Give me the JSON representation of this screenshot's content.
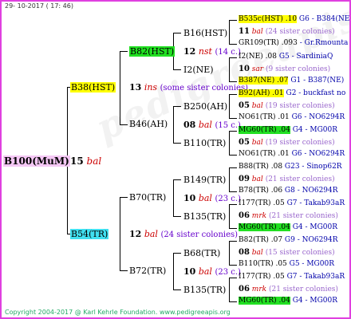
{
  "header": {
    "date": "29- 10-2017 ( 17: 46)"
  },
  "footer": {
    "copyright": "Copyright 2004-2017 @ Karl Kehrle Foundation.   www.pedigreeapis.org"
  },
  "root": {
    "name": "B100(MuM)",
    "num": "15",
    "tag": "bal"
  },
  "gen1": [
    {
      "name": "B38(HST)",
      "num": "13",
      "tag": "ins",
      "note": "(some sister colonies)"
    },
    {
      "name": "B54(TR)",
      "num": "12",
      "tag": "bal",
      "note": "(24 sister colonies)"
    }
  ],
  "gen2": [
    {
      "name": "B82(HST)"
    },
    {
      "name": "B46(AH)",
      "num": "08",
      "tag": "bal",
      "note": "(15 c.)"
    },
    {
      "name": "B70(TR)",
      "num": "10",
      "tag": "bal",
      "note": "(23 c.)"
    },
    {
      "name": "B72(TR)",
      "num": "10",
      "tag": "bal",
      "note": "(23 c.)"
    }
  ],
  "gen2b": {
    "num": "12",
    "tag": "nst",
    "note": "(14 c.)"
  },
  "gen3": [
    {
      "name": "B16(HST)"
    },
    {
      "name": "I2(NE)"
    },
    {
      "name": "B250(AH)"
    },
    {
      "name": "B110(TR)"
    },
    {
      "name": "B149(TR)"
    },
    {
      "name": "B135(TR)"
    },
    {
      "name": "B68(TR)"
    },
    {
      "name": "B135(TR)"
    }
  ],
  "gen4": [
    {
      "a": "B535c(HST) .10",
      "b": "G6 - B384(NE)"
    },
    {
      "num": "11",
      "tag": "bal",
      "note": "(24 sister colonies)"
    },
    {
      "a": "GR109(TR) .093",
      "b": "- Gr.Rmounta"
    },
    {
      "a": "I2(NE) .08",
      "b": "G5 - SardiniaQ"
    },
    {
      "num": "10",
      "tag": "sar",
      "note": "(9 sister colonies)"
    },
    {
      "a": "B387(NE) .07",
      "b": "G1 - B387(NE)"
    },
    {
      "a": "B92(AH) .01",
      "b": "G2 - buckfast no"
    },
    {
      "num": "05",
      "tag": "bal",
      "note": "(19 sister colonies)"
    },
    {
      "a": "NO61(TR) .01",
      "b": "G6 - NO6294R"
    },
    {
      "a": "MG60(TR) .04",
      "b": "G4 - MG00R"
    },
    {
      "num": "05",
      "tag": "bal",
      "note": "(19 sister colonies)"
    },
    {
      "a": "NO61(TR) .01",
      "b": "G6 - NO6294R"
    },
    {
      "a": "B88(TR) .08",
      "b": "G23 - Sinop62R"
    },
    {
      "num": "09",
      "tag": "bal",
      "note": "(21 sister colonies)"
    },
    {
      "a": "B78(TR) .06",
      "b": "G8 - NO6294R"
    },
    {
      "a": "I177(TR) .05",
      "b": "G7 - Takab93aR"
    },
    {
      "num": "06",
      "tag": "mrk",
      "note": "(21 sister colonies)"
    },
    {
      "a": "MG60(TR) .04",
      "b": "G4 - MG00R"
    },
    {
      "a": "B82(TR) .07",
      "b": "G9 - NO6294R"
    },
    {
      "num": "08",
      "tag": "bal",
      "note": "(15 sister colonies)"
    },
    {
      "a": "B110(TR) .05",
      "b": "G5 - MG00R"
    },
    {
      "a": "I177(TR) .05",
      "b": "G7 - Takab93aR"
    },
    {
      "num": "06",
      "tag": "mrk",
      "note": "(21 sister colonies)"
    },
    {
      "a": "MG60(TR) .04",
      "b": "G4 - MG00R"
    }
  ]
}
